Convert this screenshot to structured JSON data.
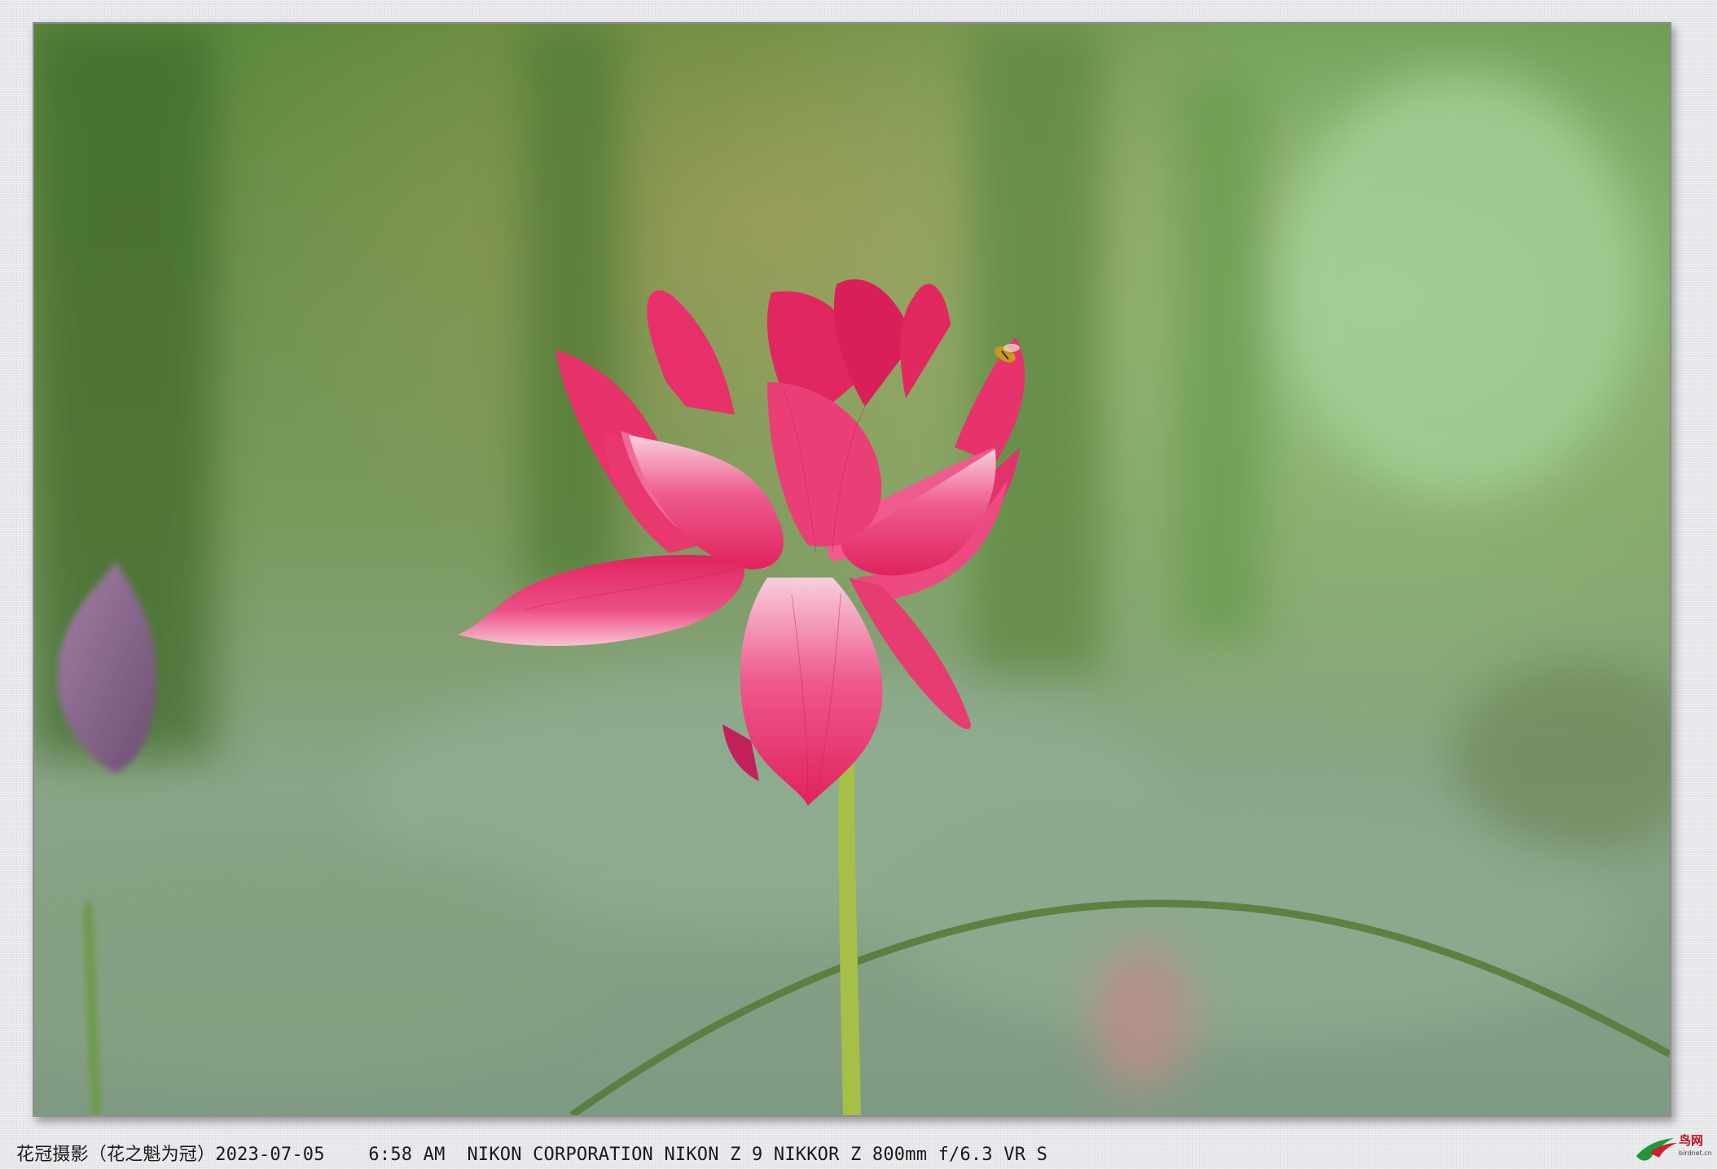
{
  "photo": {
    "subject": "pink-lotus-flower",
    "colors": {
      "petal": "#e7336e",
      "petal_light": "#f6b9cc",
      "stem": "#a9bf4a",
      "background_green": "#6f9a55",
      "bud": "#8f6a94"
    }
  },
  "caption": {
    "text": "花冠摄影（花之魁为冠）2023-07-05    6:58 AM  NIKON CORPORATION NIKON Z 9 NIKKOR Z 800mm f/6.3 VR S"
  },
  "watermark": {
    "label_cn": "鸟网",
    "domain": "birdnet.cn"
  }
}
